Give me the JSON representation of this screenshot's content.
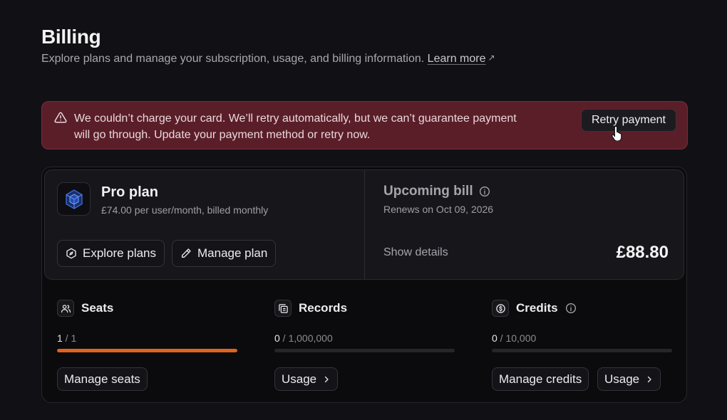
{
  "header": {
    "title": "Billing",
    "subtitle": "Explore plans and manage your subscription, usage, and billing information.",
    "learn_more": "Learn more"
  },
  "alert": {
    "message": "We couldn’t charge your card. We’ll retry automatically, but we can’t guarantee payment will go through. Update your payment method or retry now.",
    "retry_label": "Retry payment",
    "color": "#5a1e29"
  },
  "plan": {
    "name": "Pro plan",
    "price": "£74.00 per user/month, billed monthly",
    "explore_label": "Explore plans",
    "manage_label": "Manage plan"
  },
  "bill": {
    "title": "Upcoming bill",
    "renews": "Renews on Oct 09, 2026",
    "show_details": "Show details",
    "amount": "£88.80"
  },
  "usage": {
    "seats": {
      "title": "Seats",
      "used": "1",
      "total": "1",
      "fraction": 1.0,
      "button": "Manage seats"
    },
    "records": {
      "title": "Records",
      "used": "0",
      "total": "1,000,000",
      "fraction": 0,
      "button": "Usage"
    },
    "credits": {
      "title": "Credits",
      "used": "0",
      "total": "10,000",
      "fraction": 0,
      "manage_button": "Manage credits",
      "usage_button": "Usage"
    }
  },
  "colors": {
    "accent": "#e0621f",
    "background": "#111115"
  },
  "icons": [
    "warning-icon",
    "cursor-pointer-icon",
    "cube-logo-icon",
    "explore-icon",
    "pencil-icon",
    "info-icon",
    "users-icon",
    "records-icon",
    "credits-icon",
    "chevron-right-icon",
    "external-arrow-icon"
  ]
}
